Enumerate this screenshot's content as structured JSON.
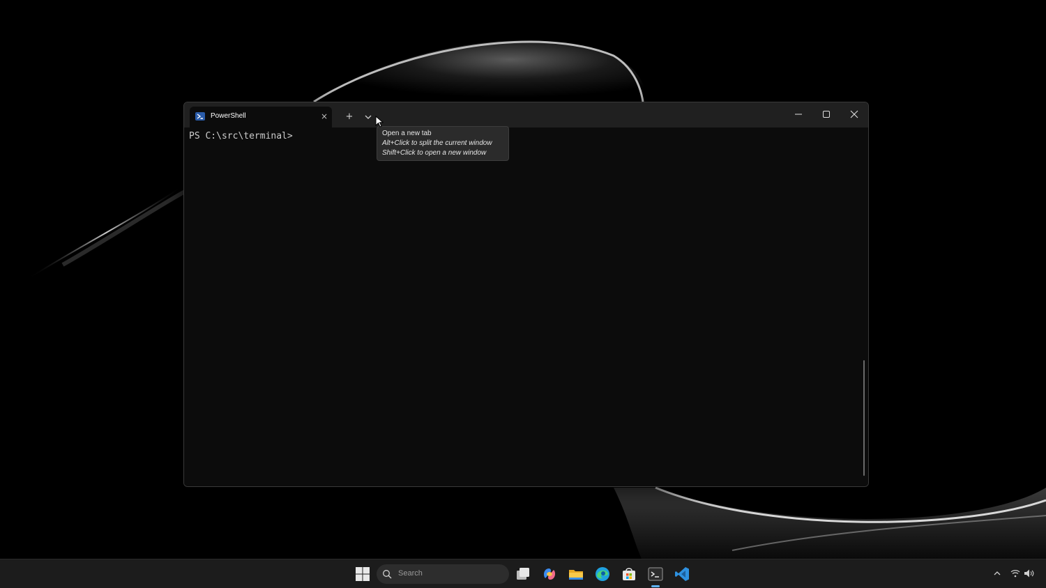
{
  "terminal": {
    "tab_title": "PowerShell",
    "tab_close": "×",
    "new_tab": "+",
    "dropdown": "⌄",
    "window_controls": {
      "minimize": "—",
      "maximize": "☐",
      "close": "✕"
    },
    "prompt": "PS C:\\src\\terminal>"
  },
  "tooltip": {
    "line1": "Open a new tab",
    "line2": "Alt+Click to split the current window",
    "line3": "Shift+Click to open a new window"
  },
  "taskbar": {
    "search_placeholder": "Search",
    "apps": [
      "start-icon",
      "task-view-icon",
      "copilot-icon",
      "file-explorer-icon",
      "edge-icon",
      "store-icon",
      "terminal-icon",
      "vscode-icon"
    ],
    "active_app": "terminal-icon",
    "tray": {
      "chevron": "^"
    }
  },
  "colors": {
    "accent": "#5fb2f2",
    "terminal_bg": "#0c0c0c",
    "titlebar_bg": "#202020",
    "taskbar_bg": "#1c1c1c"
  }
}
